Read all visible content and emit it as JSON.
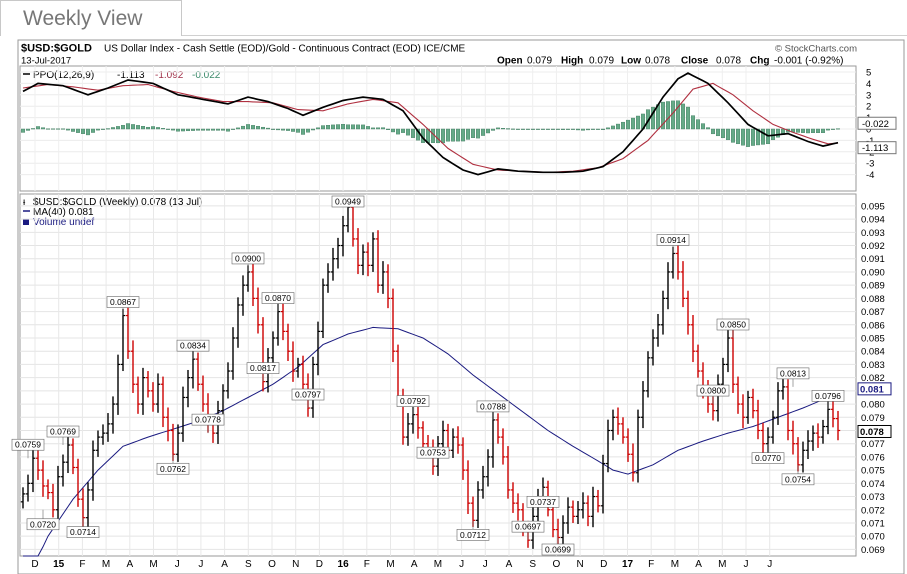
{
  "view_tab": {
    "label": "Weekly View"
  },
  "header": {
    "symbol": "$USD:$GOLD",
    "description": "US Dollar Index - Cash Settle (EOD)/Gold - Continuous Contract (EOD) ICE/CME",
    "copyright": "© StockCharts.com",
    "date": "13-Jul-2017",
    "ohlc_line": {
      "open_label": "Open",
      "open": "0.079",
      "high_label": "High",
      "high": "0.079",
      "low_label": "Low",
      "low": "0.078",
      "close_label": "Close",
      "close": "0.078",
      "chg_label": "Chg",
      "chg": "-0.001 (-0.92%)"
    }
  },
  "ppo_panel": {
    "legend_name": "PPO(12,26,9)",
    "legend_values": [
      "-1.113",
      "-1.092",
      "-0.022"
    ],
    "value_tags": [
      "-0.022",
      "-1.113"
    ],
    "y_ticks": [
      "5",
      "4",
      "3",
      "2",
      "1",
      "0",
      "-1",
      "-2",
      "-3",
      "-4"
    ]
  },
  "price_panel": {
    "legend_main": "$USD:$GOLD (Weekly) 0.078 (13 Jul)",
    "legend_ma": "MA(40) 0.081",
    "legend_volume": "Volume undef",
    "price_tags": [
      "0.081",
      "0.078"
    ],
    "y_ticks": [
      "0.095",
      "0.094",
      "0.093",
      "0.092",
      "0.091",
      "0.090",
      "0.089",
      "0.088",
      "0.087",
      "0.086",
      "0.085",
      "0.084",
      "0.083",
      "0.082",
      "0.081",
      "0.080",
      "0.079",
      "0.078",
      "0.077",
      "0.076",
      "0.075",
      "0.074",
      "0.073",
      "0.072",
      "0.071",
      "0.070",
      "0.069"
    ]
  },
  "x_axis": {
    "labels": [
      "D",
      "15",
      "F",
      "M",
      "A",
      "M",
      "J",
      "J",
      "A",
      "S",
      "O",
      "N",
      "D",
      "16",
      "F",
      "M",
      "A",
      "M",
      "J",
      "J",
      "A",
      "S",
      "O",
      "N",
      "D",
      "17",
      "F",
      "M",
      "A",
      "M",
      "J",
      "J"
    ]
  },
  "colors": {
    "up_bar": "#000000",
    "down_bar": "#cc0000",
    "ma_line": "#1a1a80",
    "ppo_line": "#000000",
    "signal_line": "#b03040",
    "histogram": "#66aa88"
  },
  "chart_data": {
    "type": "line",
    "title": "$USD:$GOLD",
    "xlabel": "",
    "ylabel": "",
    "ylim": [
      0.0685,
      0.0959
    ],
    "grid": true,
    "legend_placement": "top-left",
    "x_range_weeks": [
      0,
      134
    ],
    "ohlc_series": {
      "name": "$USD:$GOLD (Weekly)",
      "close": [
        0.0732,
        0.074,
        0.0759,
        0.075,
        0.0738,
        0.0733,
        0.072,
        0.0745,
        0.0756,
        0.0769,
        0.0752,
        0.0728,
        0.0714,
        0.0735,
        0.0765,
        0.0775,
        0.0778,
        0.0785,
        0.08,
        0.083,
        0.0867,
        0.084,
        0.0815,
        0.08,
        0.082,
        0.081,
        0.08,
        0.0815,
        0.079,
        0.078,
        0.0762,
        0.0778,
        0.0805,
        0.082,
        0.0834,
        0.0815,
        0.08,
        0.0785,
        0.0778,
        0.0795,
        0.081,
        0.0825,
        0.085,
        0.0875,
        0.089,
        0.09,
        0.088,
        0.086,
        0.0817,
        0.0835,
        0.085,
        0.087,
        0.0855,
        0.084,
        0.0825,
        0.083,
        0.0815,
        0.0797,
        0.083,
        0.0855,
        0.089,
        0.09,
        0.091,
        0.092,
        0.0935,
        0.0949,
        0.0925,
        0.0905,
        0.0915,
        0.0905,
        0.0925,
        0.089,
        0.09,
        0.088,
        0.084,
        0.0805,
        0.0775,
        0.0785,
        0.0792,
        0.0782,
        0.077,
        0.0765,
        0.0753,
        0.077,
        0.078,
        0.0765,
        0.0775,
        0.0769,
        0.075,
        0.0725,
        0.0712,
        0.0735,
        0.0745,
        0.076,
        0.0788,
        0.0775,
        0.076,
        0.0735,
        0.0725,
        0.072,
        0.0705,
        0.0697,
        0.0715,
        0.073,
        0.0737,
        0.072,
        0.0705,
        0.0699,
        0.071,
        0.0722,
        0.0715,
        0.072,
        0.0725,
        0.0715,
        0.073,
        0.0723,
        0.0755,
        0.078,
        0.079,
        0.0785,
        0.0775,
        0.0762,
        0.0748,
        0.079,
        0.081,
        0.0835,
        0.085,
        0.086,
        0.088,
        0.09,
        0.0914,
        0.09,
        0.088,
        0.086,
        0.084,
        0.0825,
        0.081,
        0.08,
        0.0795,
        0.0815,
        0.083,
        0.085,
        0.0815,
        0.08,
        0.079,
        0.0805,
        0.0795,
        0.078,
        0.077,
        0.0775,
        0.079,
        0.081,
        0.0813,
        0.078,
        0.077,
        0.0754,
        0.0765,
        0.0772,
        0.0778,
        0.0775,
        0.0783,
        0.0796,
        0.0789,
        0.078
      ]
    },
    "annotations": [
      {
        "label": "0.0759",
        "week": 1
      },
      {
        "label": "0.0720",
        "week": 4
      },
      {
        "label": "0.0769",
        "week": 8
      },
      {
        "label": "0.0714",
        "week": 12
      },
      {
        "label": "0.0867",
        "week": 20
      },
      {
        "label": "0.0762",
        "week": 30
      },
      {
        "label": "0.0834",
        "week": 34
      },
      {
        "label": "0.0778",
        "week": 37
      },
      {
        "label": "0.0900",
        "week": 45
      },
      {
        "label": "0.0817",
        "week": 48
      },
      {
        "label": "0.0870",
        "week": 51
      },
      {
        "label": "0.0797",
        "week": 57
      },
      {
        "label": "0.0949",
        "week": 65
      },
      {
        "label": "0.0792",
        "week": 78
      },
      {
        "label": "0.0753",
        "week": 82
      },
      {
        "label": "0.0712",
        "week": 90
      },
      {
        "label": "0.0788",
        "week": 94
      },
      {
        "label": "0.0737",
        "week": 104
      },
      {
        "label": "0.0697",
        "week": 101
      },
      {
        "label": "0.0699",
        "week": 107
      },
      {
        "label": "0.0914",
        "week": 130
      },
      {
        "label": "0.0850",
        "week": 142
      },
      {
        "label": "0.0800",
        "week": 138
      },
      {
        "label": "0.0770",
        "week": 149
      },
      {
        "label": "0.0813",
        "week": 154
      },
      {
        "label": "0.0754",
        "week": 155
      },
      {
        "label": "0.0796",
        "week": 161
      }
    ],
    "ma40_series": {
      "name": "MA(40)",
      "anchors": [
        [
          0,
          0.066
        ],
        [
          5,
          0.07
        ],
        [
          10,
          0.0728
        ],
        [
          15,
          0.075
        ],
        [
          20,
          0.0768
        ],
        [
          25,
          0.0775
        ],
        [
          30,
          0.0781
        ],
        [
          35,
          0.0787
        ],
        [
          40,
          0.0795
        ],
        [
          45,
          0.0805
        ],
        [
          50,
          0.0815
        ],
        [
          55,
          0.0828
        ],
        [
          60,
          0.0845
        ],
        [
          65,
          0.0853
        ],
        [
          70,
          0.0858
        ],
        [
          75,
          0.0857
        ],
        [
          80,
          0.085
        ],
        [
          85,
          0.0838
        ],
        [
          90,
          0.0822
        ],
        [
          95,
          0.0808
        ],
        [
          100,
          0.0794
        ],
        [
          105,
          0.078
        ],
        [
          110,
          0.0768
        ],
        [
          115,
          0.0757
        ],
        [
          118,
          0.075
        ],
        [
          121,
          0.0747
        ],
        [
          126,
          0.0754
        ],
        [
          131,
          0.0765
        ],
        [
          136,
          0.0772
        ],
        [
          141,
          0.0778
        ],
        [
          146,
          0.0783
        ],
        [
          151,
          0.079
        ],
        [
          156,
          0.0797
        ],
        [
          161,
          0.0805
        ],
        [
          164,
          0.081
        ]
      ]
    },
    "ppo_series": [
      {
        "name": "PPO",
        "anchors": [
          [
            0,
            3.3
          ],
          [
            3,
            4.0
          ],
          [
            8,
            3.8
          ],
          [
            13,
            3.0
          ],
          [
            17,
            3.6
          ],
          [
            21,
            4.3
          ],
          [
            26,
            4.0
          ],
          [
            31,
            3.0
          ],
          [
            36,
            2.6
          ],
          [
            41,
            2.2
          ],
          [
            45,
            2.8
          ],
          [
            49,
            2.4
          ],
          [
            53,
            1.8
          ],
          [
            56,
            1.2
          ],
          [
            60,
            1.9
          ],
          [
            64,
            2.5
          ],
          [
            68,
            2.8
          ],
          [
            72,
            2.6
          ],
          [
            76,
            1.6
          ],
          [
            80,
            -0.8
          ],
          [
            84,
            -2.5
          ],
          [
            88,
            -3.6
          ],
          [
            91,
            -4.0
          ],
          [
            95,
            -3.5
          ],
          [
            99,
            -3.7
          ],
          [
            104,
            -3.8
          ],
          [
            108,
            -3.8
          ],
          [
            112,
            -3.7
          ],
          [
            116,
            -3.3
          ],
          [
            120,
            -2.0
          ],
          [
            124,
            0.0
          ],
          [
            128,
            2.8
          ],
          [
            131,
            4.4
          ],
          [
            133,
            4.9
          ],
          [
            137,
            4.0
          ],
          [
            141,
            2.3
          ],
          [
            145,
            0.4
          ],
          [
            149,
            -0.6
          ],
          [
            153,
            -0.4
          ],
          [
            157,
            -1.1
          ],
          [
            160,
            -1.5
          ],
          [
            164,
            -1.1
          ]
        ]
      },
      {
        "name": "Signal",
        "anchors": [
          [
            0,
            3.6
          ],
          [
            5,
            3.9
          ],
          [
            10,
            3.7
          ],
          [
            15,
            3.4
          ],
          [
            20,
            3.8
          ],
          [
            25,
            3.9
          ],
          [
            30,
            3.3
          ],
          [
            35,
            2.8
          ],
          [
            40,
            2.4
          ],
          [
            45,
            2.4
          ],
          [
            50,
            2.3
          ],
          [
            55,
            1.7
          ],
          [
            60,
            1.6
          ],
          [
            65,
            2.2
          ],
          [
            70,
            2.6
          ],
          [
            75,
            2.3
          ],
          [
            80,
            0.4
          ],
          [
            85,
            -1.7
          ],
          [
            90,
            -3.1
          ],
          [
            95,
            -3.6
          ],
          [
            100,
            -3.7
          ],
          [
            105,
            -3.8
          ],
          [
            110,
            -3.7
          ],
          [
            115,
            -3.4
          ],
          [
            120,
            -2.6
          ],
          [
            125,
            -1.0
          ],
          [
            130,
            1.4
          ],
          [
            134,
            3.5
          ],
          [
            138,
            4.0
          ],
          [
            142,
            3.0
          ],
          [
            146,
            1.6
          ],
          [
            150,
            0.4
          ],
          [
            154,
            -0.3
          ],
          [
            158,
            -0.9
          ],
          [
            161,
            -1.3
          ],
          [
            164,
            -1.2
          ]
        ]
      }
    ]
  }
}
